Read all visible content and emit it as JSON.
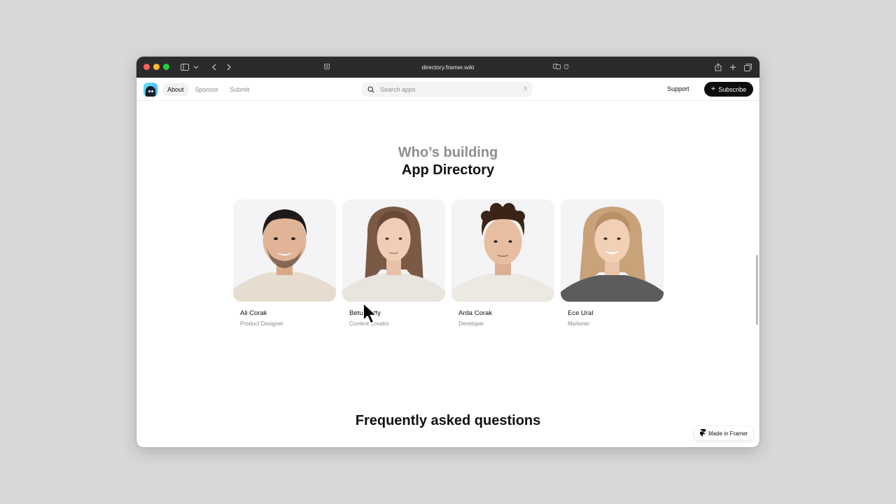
{
  "browser": {
    "url": "directory.framer.wiki"
  },
  "header": {
    "nav": [
      {
        "label": "About",
        "active": true
      },
      {
        "label": "Sponsor",
        "active": false
      },
      {
        "label": "Submit",
        "active": false
      }
    ],
    "search": {
      "placeholder": "Search apps",
      "shortcut": "S"
    },
    "support_label": "Support",
    "subscribe_label": "Subscribe"
  },
  "team_section": {
    "heading_top": "Who’s building",
    "heading_bottom": "App Directory",
    "members": [
      {
        "name": "Ali Corak",
        "role": "Product Designer"
      },
      {
        "name": "Betul Yetty",
        "role": "Content Creator"
      },
      {
        "name": "Arda Corak",
        "role": "Developer"
      },
      {
        "name": "Ece Ural",
        "role": "Marketer"
      }
    ]
  },
  "faq": {
    "title": "Frequently asked questions"
  },
  "badge": {
    "label": "Made in Framer"
  },
  "colors": {
    "accent": "#0d0d0d",
    "muted_heading": "#8e8e8e",
    "chrome": "#2b2b2d"
  }
}
